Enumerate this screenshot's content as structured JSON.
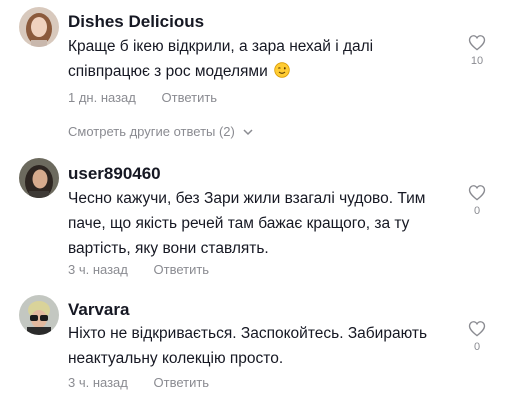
{
  "comments": [
    {
      "username": "Dishes Delicious",
      "text_line1": "Краще б ікею відкрили, а зара нехай і далі",
      "text_line2": "співпрацює з рос моделями",
      "emoji": "winking-face-emoji",
      "time": "1 дн. назад",
      "reply_label": "Ответить",
      "likes": "10"
    },
    {
      "username": "user890460",
      "text_line1": "Чесно кажучи, без Зари жили взагалі чудово. Тим",
      "text_line2": "паче, що якість речей там бажає кращого, за ту",
      "text_line3": "вартість, яку вони ставлять.",
      "time": "3 ч. назад",
      "reply_label": "Ответить",
      "likes": "0"
    },
    {
      "username": "Varvara",
      "text_line1": "Ніхто не відкривається. Заспокойтесь. Забирають",
      "text_line2": "неактуальну колекцію просто.",
      "time": "3 ч. назад",
      "reply_label": "Ответить",
      "likes": "0"
    }
  ],
  "more_replies_label": "Смотреть другие ответы (2)",
  "colors": {
    "text": "#161823",
    "muted": "#8a8b91"
  }
}
